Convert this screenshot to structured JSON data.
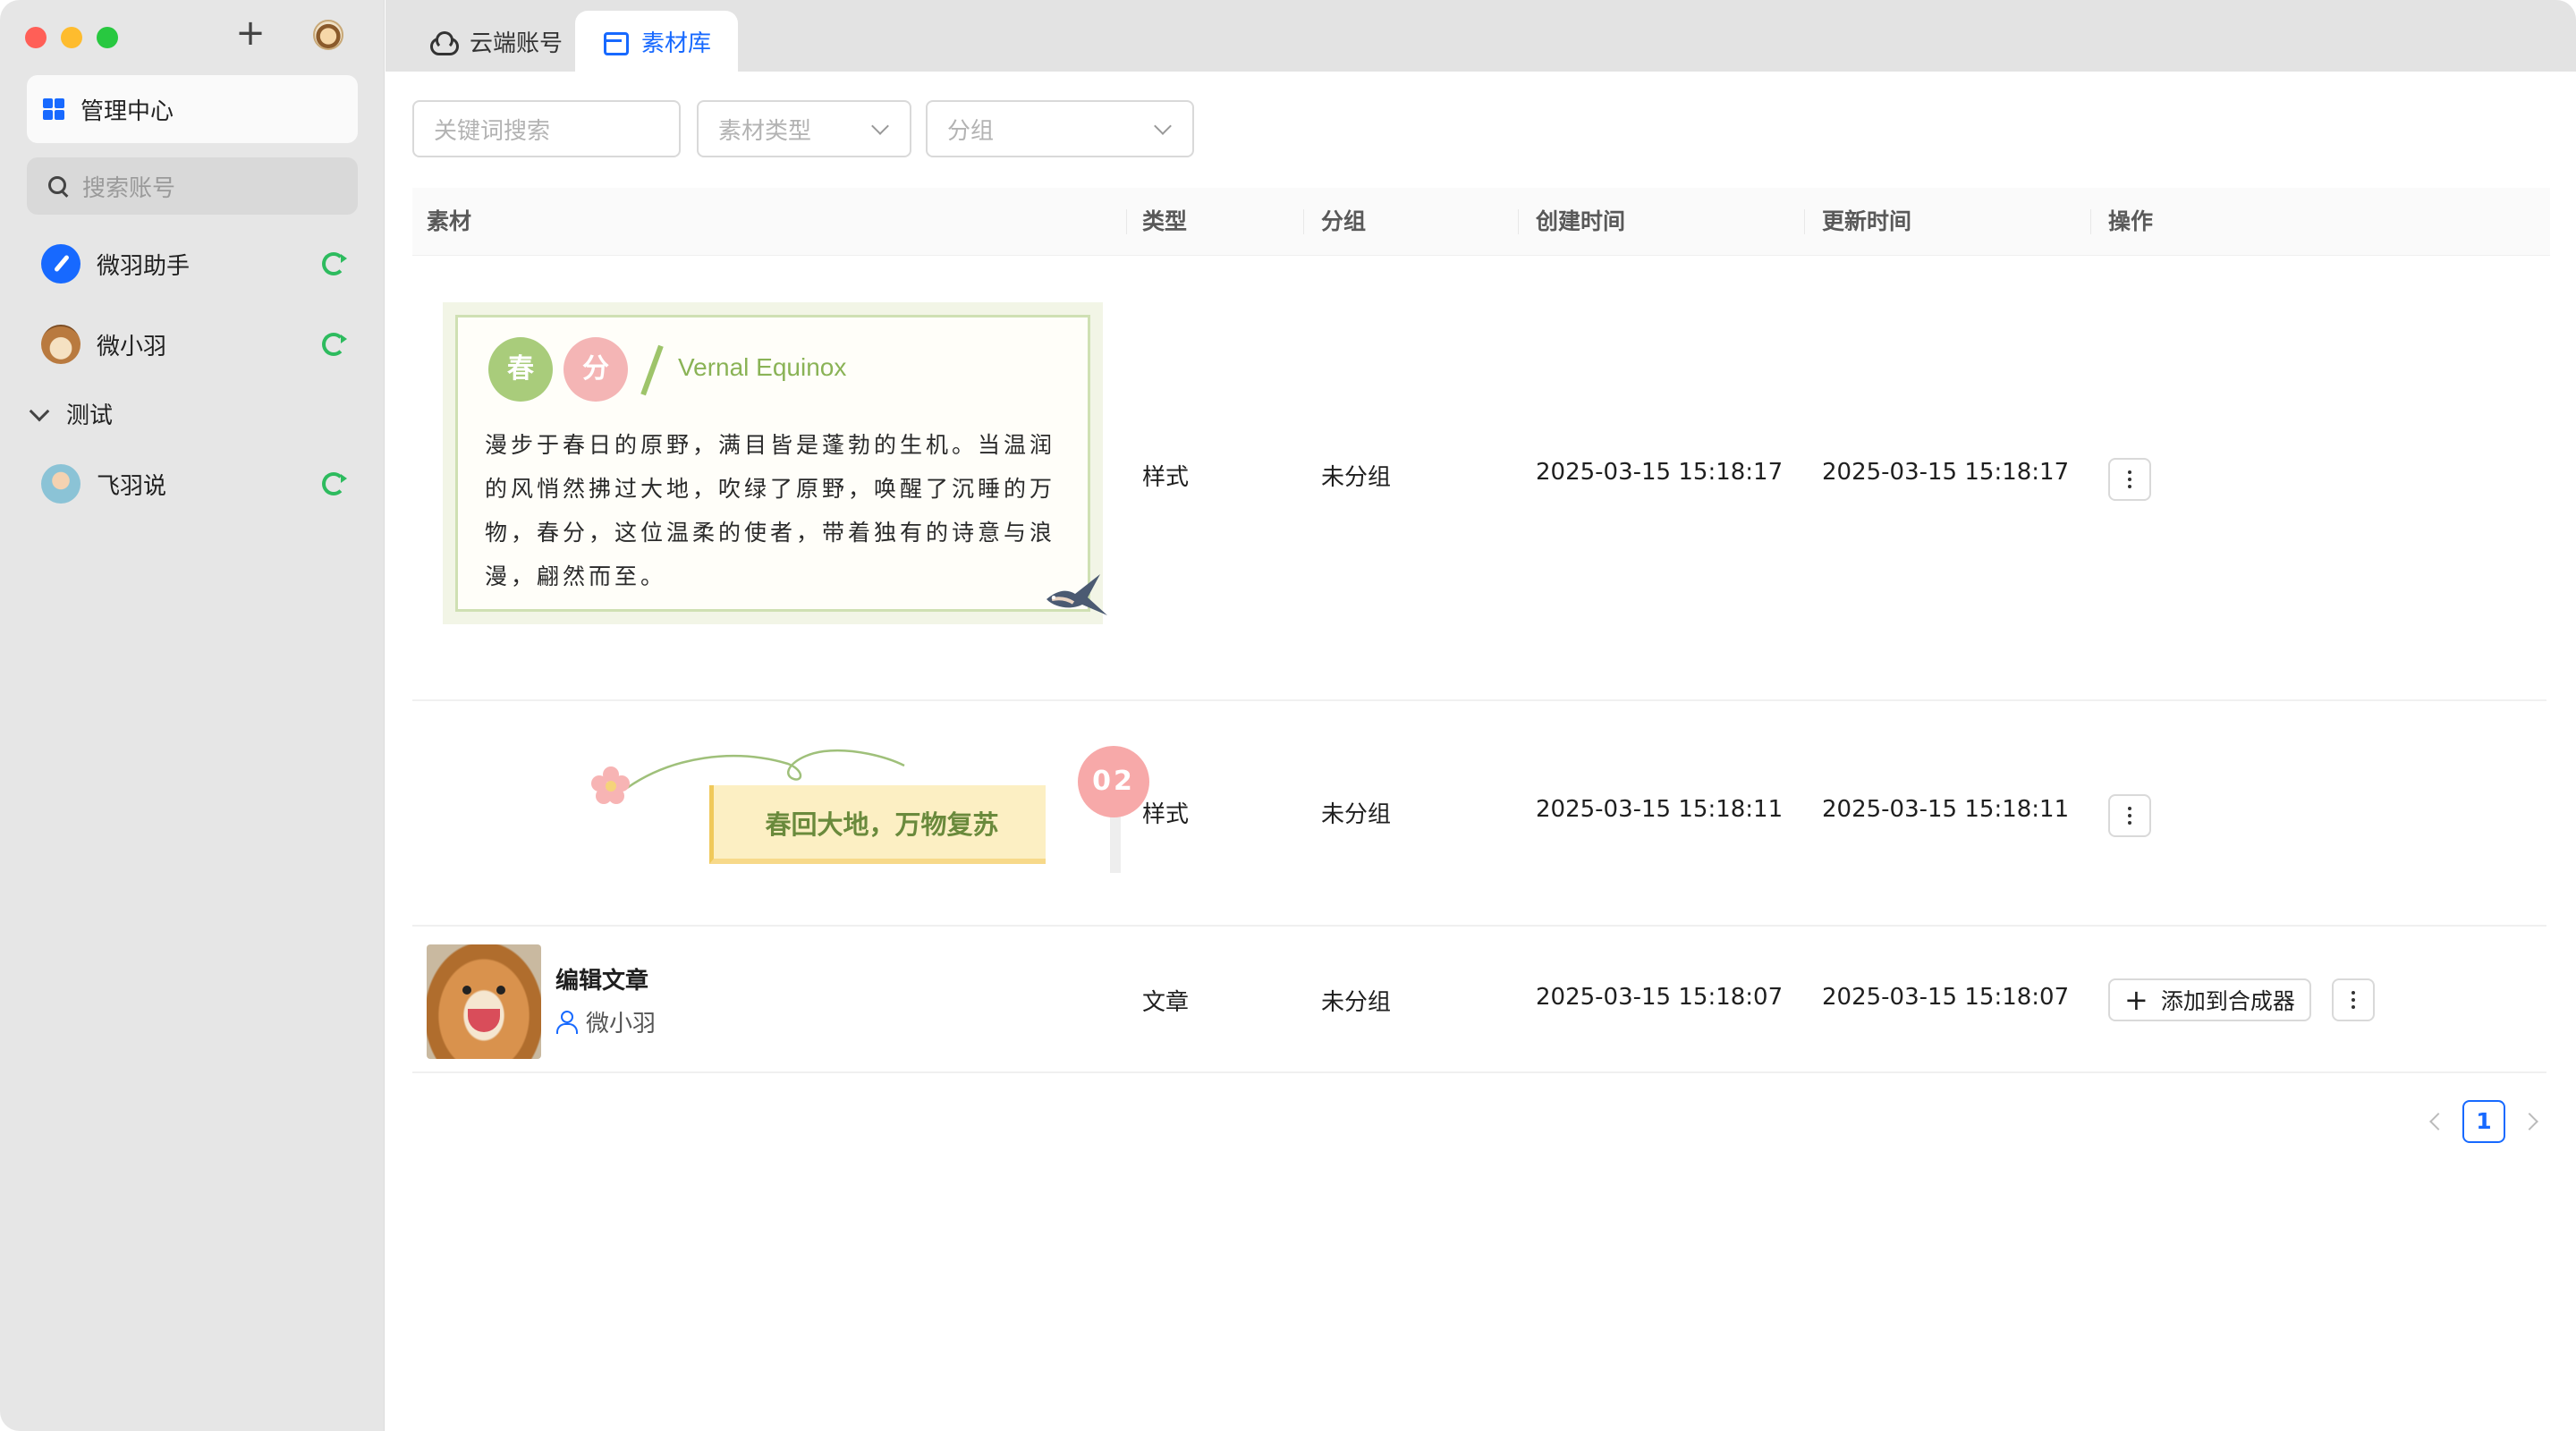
{
  "sidebar": {
    "management": "管理中心",
    "search_placeholder": "搜索账号",
    "accounts": [
      {
        "name": "微羽助手"
      },
      {
        "name": "微小羽"
      }
    ],
    "group": {
      "name": "测试",
      "accounts": [
        {
          "name": "飞羽说"
        }
      ]
    }
  },
  "tabs": [
    {
      "label": "云端账号",
      "active": false
    },
    {
      "label": "素材库",
      "active": true
    }
  ],
  "filters": {
    "keyword_placeholder": "关键词搜索",
    "type_placeholder": "素材类型",
    "group_placeholder": "分组"
  },
  "table": {
    "columns": [
      "素材",
      "类型",
      "分组",
      "创建时间",
      "更新时间",
      "操作"
    ],
    "rows": [
      {
        "material": {
          "badge1": "春",
          "badge2": "分",
          "english": "Vernal Equinox",
          "text": "漫步于春日的原野，满目皆是蓬勃的生机。当温润的风悄然拂过大地，吹绿了原野，唤醒了沉睡的万物，春分，这位温柔的使者，带着独有的诗意与浪漫，翩然而至。"
        },
        "type": "样式",
        "group": "未分组",
        "created": "2025-03-15 15:18:17",
        "updated": "2025-03-15 15:18:17"
      },
      {
        "material": {
          "number": "02",
          "text": "春回大地，万物复苏"
        },
        "type": "样式",
        "group": "未分组",
        "created": "2025-03-15 15:18:11",
        "updated": "2025-03-15 15:18:11"
      },
      {
        "material": {
          "title": "编辑文章",
          "author": "微小羽"
        },
        "type": "文章",
        "group": "未分组",
        "created": "2025-03-15 15:18:07",
        "updated": "2025-03-15 15:18:07",
        "action_label": "添加到合成器"
      }
    ]
  },
  "pagination": {
    "current": "1"
  },
  "colors": {
    "accent": "#1769ff",
    "sync_green": "#2dbb5e"
  }
}
